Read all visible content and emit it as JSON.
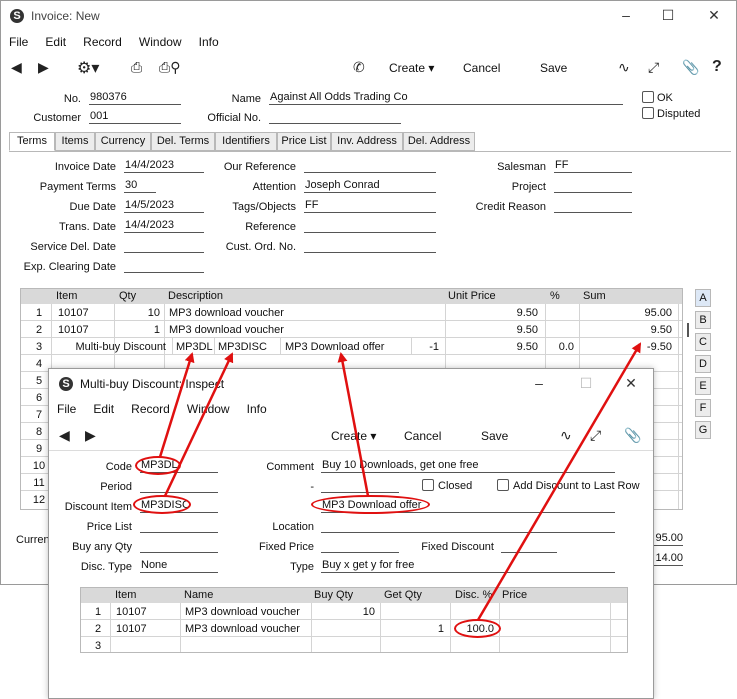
{
  "main": {
    "title": "Invoice: New",
    "menu": [
      "File",
      "Edit",
      "Record",
      "Window",
      "Info"
    ],
    "toolbar": {
      "create": "Create",
      "cancel": "Cancel",
      "save": "Save"
    },
    "header": {
      "no_label": "No.",
      "no": "980376",
      "name_label": "Name",
      "name": "Against All Odds Trading Co",
      "customer_label": "Customer",
      "customer": "001",
      "official_no_label": "Official No.",
      "official_no": "",
      "ok_label": "OK",
      "disputed_label": "Disputed"
    },
    "tabs": [
      "Terms",
      "Items",
      "Currency",
      "Del. Terms",
      "Identifiers",
      "Price List",
      "Inv. Address",
      "Del. Address"
    ],
    "terms": {
      "invoice_date_label": "Invoice Date",
      "invoice_date": "14/4/2023",
      "payment_terms_label": "Payment Terms",
      "payment_terms": "30",
      "due_date_label": "Due Date",
      "due_date": "14/5/2023",
      "trans_date_label": "Trans. Date",
      "trans_date": "14/4/2023",
      "service_del_label": "Service Del. Date",
      "service_del": "",
      "exp_clearing_label": "Exp. Clearing Date",
      "exp_clearing": "",
      "our_ref_label": "Our Reference",
      "our_ref": "",
      "attention_label": "Attention",
      "attention": "Joseph Conrad",
      "tags_label": "Tags/Objects",
      "tags": "FF",
      "reference_label": "Reference",
      "reference": "",
      "cust_ord_label": "Cust. Ord. No.",
      "cust_ord": "",
      "salesman_label": "Salesman",
      "salesman": "FF",
      "project_label": "Project",
      "project": "",
      "credit_reason_label": "Credit Reason",
      "credit_reason": ""
    },
    "grid": {
      "headers": {
        "item": "Item",
        "qty": "Qty",
        "description": "Description",
        "unit_price": "Unit Price",
        "pct": "%",
        "sum": "Sum"
      },
      "rows": [
        {
          "n": "1",
          "item": "10107",
          "qty": "10",
          "description": "MP3 download voucher",
          "unit_price": "9.50",
          "pct": "",
          "sum": "95.00"
        },
        {
          "n": "2",
          "item": "10107",
          "qty": "1",
          "description": "MP3 download voucher",
          "unit_price": "9.50",
          "pct": "",
          "sum": "9.50"
        }
      ],
      "row3": {
        "n": "3",
        "type": "Multi-buy Discount",
        "code": "MP3DL",
        "disc_item": "MP3DISC",
        "offer": "MP3 Download offer",
        "qty": "-1",
        "unit_price": "9.50",
        "pct": "0.0",
        "sum": "-9.50"
      },
      "empty_rows": [
        "4",
        "5",
        "6",
        "7",
        "8",
        "9",
        "10",
        "11",
        "12"
      ],
      "side_tabs": [
        "A",
        "B",
        "C",
        "D",
        "E",
        "F",
        "G"
      ]
    },
    "footer": {
      "currency_label": "Curren",
      "total1": "95.00",
      "total2": "14.00"
    }
  },
  "dialog": {
    "title": "Multi-buy Discount: Inspect",
    "menu": [
      "File",
      "Edit",
      "Record",
      "Window",
      "Info"
    ],
    "toolbar": {
      "create": "Create",
      "cancel": "Cancel",
      "save": "Save"
    },
    "form": {
      "code_label": "Code",
      "code": "MP3DL",
      "period_label": "Period",
      "period": "",
      "discount_item_label": "Discount Item",
      "discount_item": "MP3DISC",
      "price_list_label": "Price List",
      "price_list": "",
      "buy_any_qty_label": "Buy any Qty",
      "buy_any_qty": "",
      "disc_type_label": "Disc. Type",
      "disc_type": "None",
      "comment_label": "Comment",
      "comment": "Buy 10 Downloads, get one free",
      "period_dash": "-",
      "closed_label": "Closed",
      "add_to_last_row_label": "Add Discount to Last Row",
      "offer": "MP3 Download offer",
      "location_label": "Location",
      "location": "",
      "fixed_price_label": "Fixed Price",
      "fixed_price": "",
      "fixed_discount_label": "Fixed Discount",
      "fixed_discount": "",
      "type_label": "Type",
      "type": "Buy x get y for free"
    },
    "grid": {
      "headers": {
        "item": "Item",
        "name": "Name",
        "buy_qty": "Buy Qty",
        "get_qty": "Get Qty",
        "disc_pct": "Disc. %",
        "price": "Price"
      },
      "rows": [
        {
          "n": "1",
          "item": "10107",
          "name": "MP3 download voucher",
          "buy_qty": "10",
          "get_qty": "",
          "disc_pct": "",
          "price": ""
        },
        {
          "n": "2",
          "item": "10107",
          "name": "MP3 download voucher",
          "buy_qty": "",
          "get_qty": "1",
          "disc_pct": "100.0",
          "price": ""
        },
        {
          "n": "3",
          "item": "",
          "name": "",
          "buy_qty": "",
          "get_qty": "",
          "disc_pct": "",
          "price": ""
        }
      ]
    }
  },
  "annotation_color": "#e01010"
}
